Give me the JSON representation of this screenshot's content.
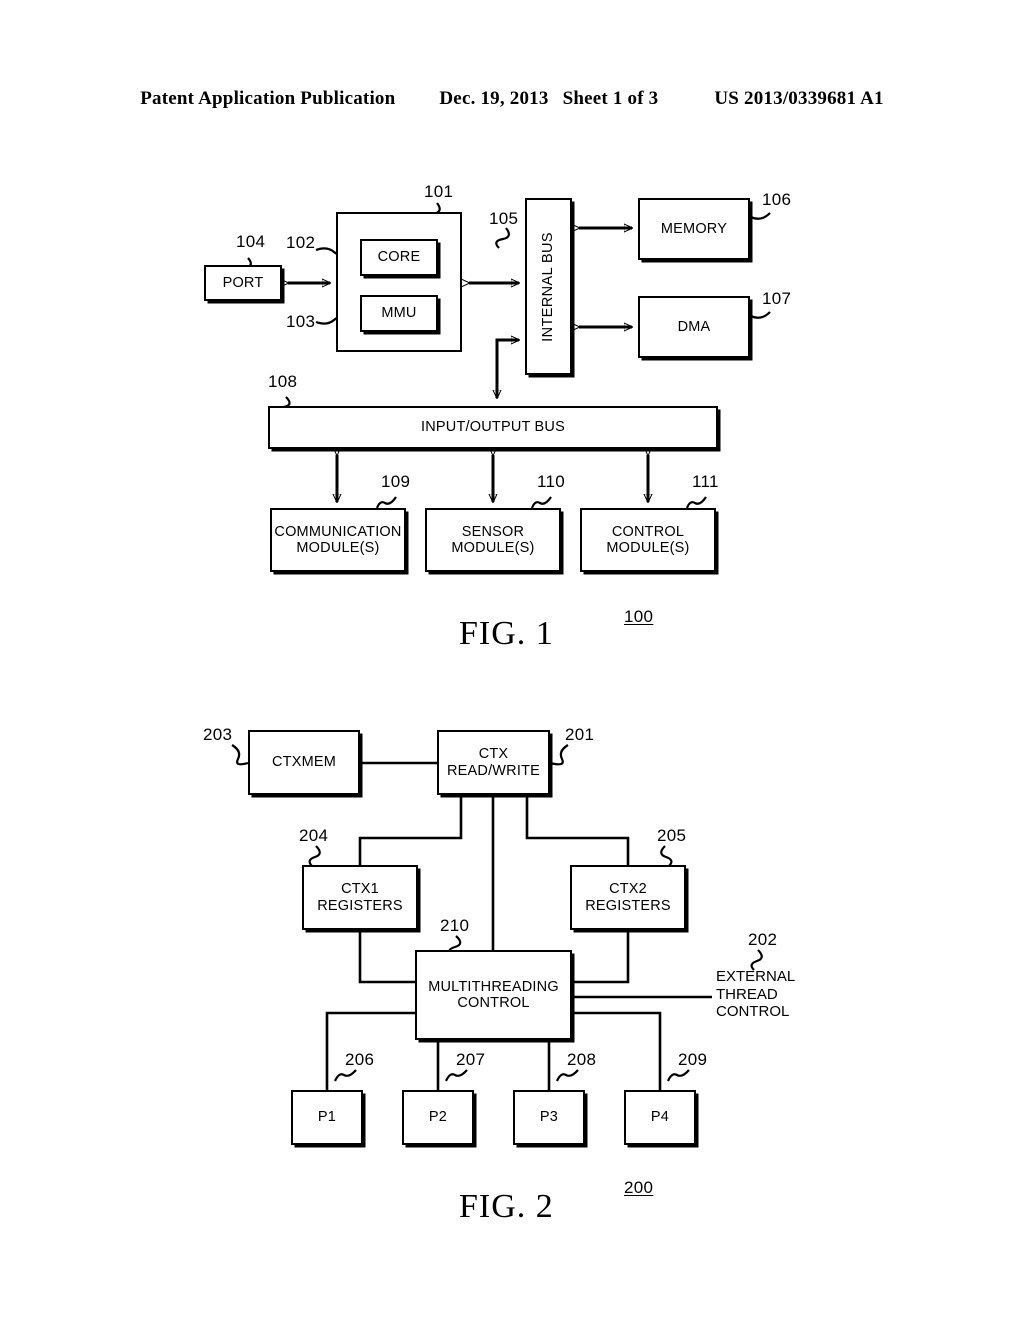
{
  "header": {
    "publication": "Patent Application Publication",
    "date": "Dec. 19, 2013",
    "sheet": "Sheet 1 of 3",
    "patent_number": "US 2013/0339681 A1"
  },
  "figure1": {
    "caption": "FIG. 1",
    "figure_ref": "100",
    "blocks": [
      {
        "id": "port",
        "label": "PORT",
        "ref": "104"
      },
      {
        "id": "cpu",
        "label": "",
        "ref": "101"
      },
      {
        "id": "core",
        "label": "CORE",
        "ref": "102"
      },
      {
        "id": "mmu",
        "label": "MMU",
        "ref": "103"
      },
      {
        "id": "intbus",
        "label": "INTERNAL BUS",
        "ref": "105"
      },
      {
        "id": "memory",
        "label": "MEMORY",
        "ref": "106"
      },
      {
        "id": "dma",
        "label": "DMA",
        "ref": "107"
      },
      {
        "id": "iobus",
        "label": "INPUT/OUTPUT BUS",
        "ref": "108"
      },
      {
        "id": "comm",
        "label": "COMMUNICATION MODULE(S)",
        "ref": "109"
      },
      {
        "id": "sensor",
        "label": "SENSOR MODULE(S)",
        "ref": "110"
      },
      {
        "id": "control",
        "label": "CONTROL MODULE(S)",
        "ref": "111"
      }
    ],
    "labels": {
      "port": "PORT",
      "core": "CORE",
      "mmu": "MMU",
      "internal_bus": "INTERNAL BUS",
      "memory": "MEMORY",
      "dma": "DMA",
      "io_bus": "INPUT/OUTPUT BUS",
      "comm_line1": "COMMUNICATION",
      "comm_line2": "MODULE(S)",
      "sensor_line1": "SENSOR",
      "sensor_line2": "MODULE(S)",
      "control_line1": "CONTROL",
      "control_line2": "MODULE(S)"
    },
    "refs": {
      "r101": "101",
      "r102": "102",
      "r103": "103",
      "r104": "104",
      "r105": "105",
      "r106": "106",
      "r107": "107",
      "r108": "108",
      "r109": "109",
      "r110": "110",
      "r111": "111"
    }
  },
  "figure2": {
    "caption": "FIG. 2",
    "figure_ref": "200",
    "labels": {
      "ctxmem": "CTXMEM",
      "ctx_rw_line1": "CTX",
      "ctx_rw_line2": "READ/WRITE",
      "ctx1_line1": "CTX1",
      "ctx1_line2": "REGISTERS",
      "ctx2_line1": "CTX2",
      "ctx2_line2": "REGISTERS",
      "mt_line1": "MULTITHREADING",
      "mt_line2": "CONTROL",
      "ext_line1": "EXTERNAL",
      "ext_line2": "THREAD",
      "ext_line3": "CONTROL",
      "p1": "P1",
      "p2": "P2",
      "p3": "P3",
      "p4": "P4"
    },
    "refs": {
      "r201": "201",
      "r202": "202",
      "r203": "203",
      "r204": "204",
      "r205": "205",
      "r206": "206",
      "r207": "207",
      "r208": "208",
      "r209": "209",
      "r210": "210"
    }
  },
  "colors": {
    "ink": "#000000",
    "paper": "#ffffff"
  }
}
